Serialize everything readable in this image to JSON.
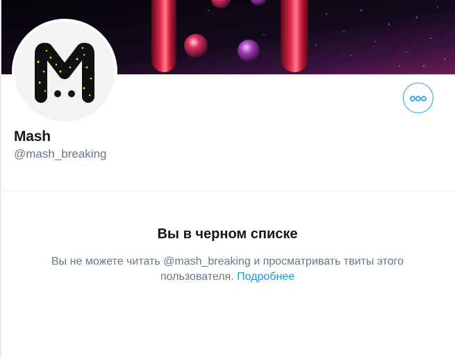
{
  "profile": {
    "display_name": "Mash",
    "screen_name": "@mash_breaking",
    "avatar_icon": "mash-m-logo-icon",
    "more_button_icon": "more-dots-icon"
  },
  "blocked_notice": {
    "title": "Вы в черном списке",
    "message": "Вы не можете читать @mash_breaking и просматривать твиты этого пользователя.",
    "link_label": "Подробнее"
  },
  "colors": {
    "accent": "#1da1f2",
    "link": "#1b95e0",
    "secondary_text": "#657786",
    "primary_text": "#14171a",
    "divider": "#e6ecf0"
  }
}
